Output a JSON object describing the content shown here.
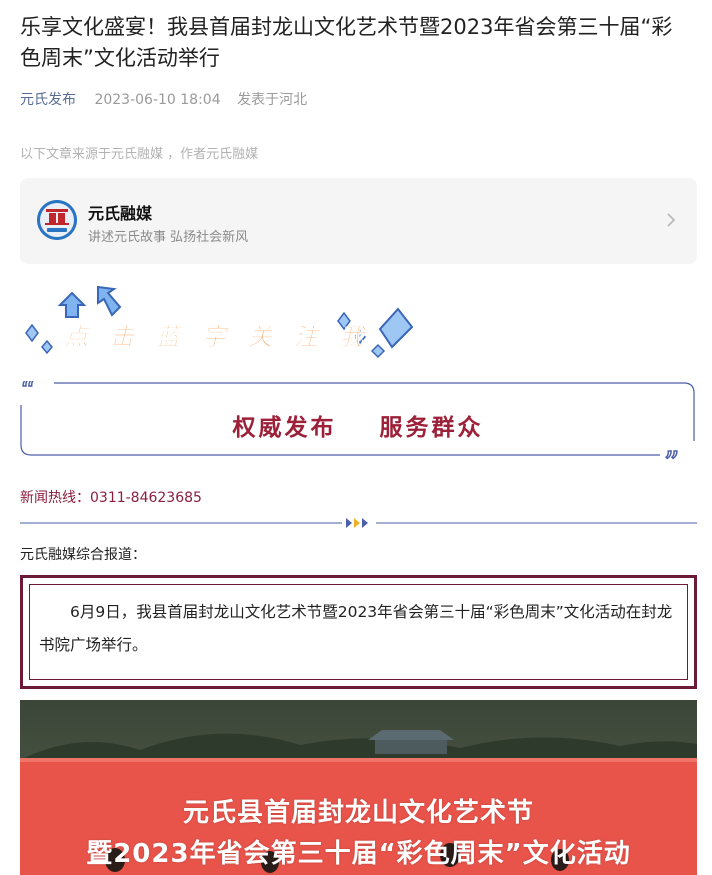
{
  "article": {
    "title": "乐享文化盛宴！我县首届封龙山文化艺术节暨2023年省会第三十届“彩色周末”文化活动举行",
    "author": "元氏发布",
    "date": "2023-06-10 18:04",
    "location": "发表于河北",
    "source_note": "以下文章来源于元氏融媒 ，作者元氏融媒"
  },
  "account_card": {
    "name": "元氏融媒",
    "description": "讲述元氏故事 弘扬社会新风",
    "logo_text": "元氏融媒",
    "icon": "chevron-right-icon"
  },
  "follow_banner": {
    "text": "点击蓝字关注我",
    "chars": [
      "点",
      "击",
      "蓝",
      "字",
      "关",
      "注",
      "我"
    ]
  },
  "slogan": {
    "left": "权威发布",
    "right": "服务群众"
  },
  "hotline": "新闻热线：0311-84623685",
  "report_intro": "元氏融媒综合报道：",
  "lead_paragraph": "6月9日，我县首届封龙山文化艺术节暨2023年省会第三十届“彩色周末”文化活动在封龙书院广场举行。",
  "photo": {
    "banner_line1": "元氏县首届封龙山文化艺术节",
    "banner_line2": "暨2023年省会第三十届“彩色周末”文化活动"
  },
  "colors": {
    "accent_red": "#9c2037",
    "frame_maroon": "#6b1a38",
    "link_blue": "#576b95",
    "quote_blue": "#4a5fa8",
    "banner_red": "#e8534a"
  }
}
